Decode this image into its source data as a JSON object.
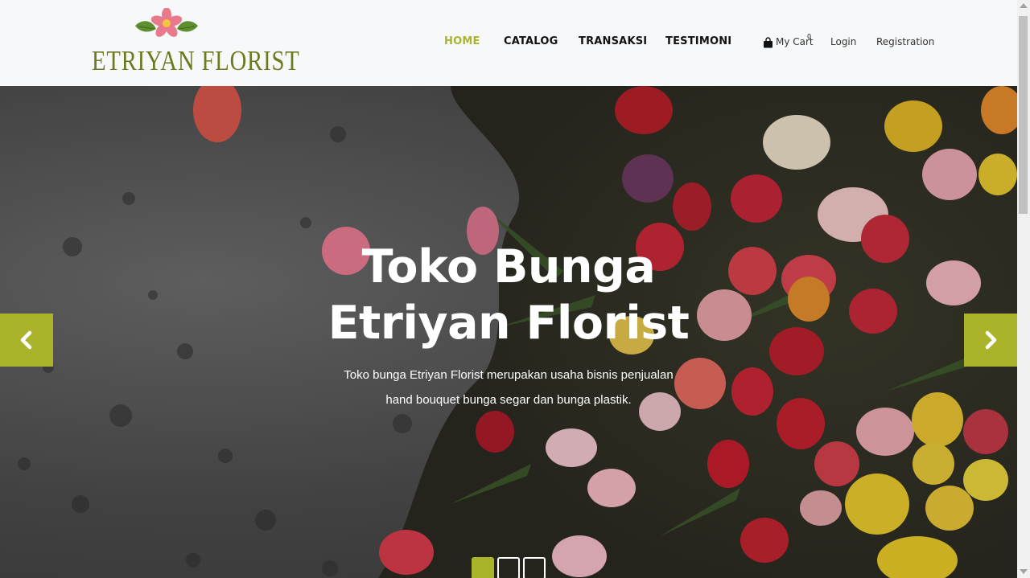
{
  "brand": {
    "name": "ETRIYAN FLORIST",
    "logo_icon": "flower-icon"
  },
  "nav": {
    "items": [
      {
        "label": "HOME",
        "active": true
      },
      {
        "label": "CATALOG",
        "active": false
      },
      {
        "label": "TRANSAKSI",
        "active": false
      },
      {
        "label": "TESTIMONI",
        "active": false
      }
    ]
  },
  "utility": {
    "cart_label": "My Cart",
    "cart_count": "0",
    "cart_icon": "shopping-bag-icon",
    "login_label": "Login",
    "registration_label": "Registration"
  },
  "hero": {
    "title_line1": "Toko Bunga",
    "title_line2": "Etriyan Florist",
    "desc_line1": "Toko bunga Etriyan Florist merupakan usaha bisnis penjualan",
    "desc_line2": "hand bouquet bunga segar dan bunga plastik.",
    "prev_icon": "chevron-left-icon",
    "next_icon": "chevron-right-icon",
    "slide_count": 3,
    "active_slide": 1
  },
  "colors": {
    "accent": "#aab42b",
    "brand_text": "#6b7a1e",
    "nav_text": "#111111"
  }
}
